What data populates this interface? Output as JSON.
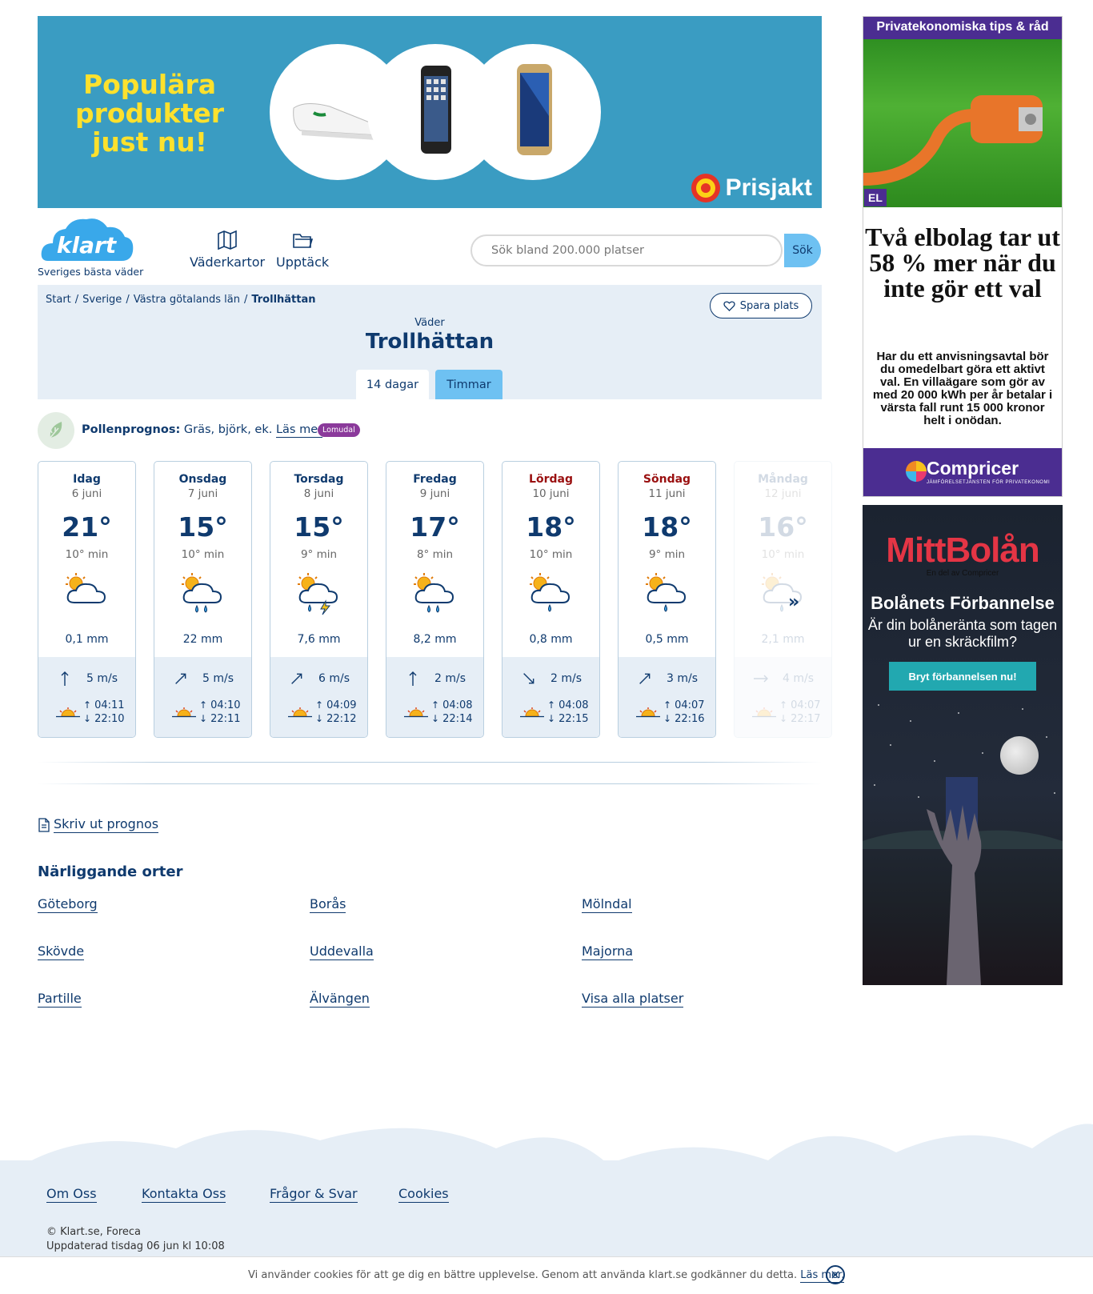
{
  "top_ad": {
    "headline": "Populära produkter just nu!",
    "brand": "Prisjakt",
    "colors": {
      "background": "#3a9cc2",
      "headline": "#fde12d"
    }
  },
  "header": {
    "logo_text": "klart",
    "tagline": "Sveriges bästa väder",
    "nav": [
      {
        "label": "Väderkartor",
        "icon": "map-icon"
      },
      {
        "label": "Upptäck",
        "icon": "folder-icon"
      }
    ],
    "search": {
      "placeholder": "Sök bland 200.000 platser",
      "button": "Sök"
    }
  },
  "location": {
    "breadcrumb": [
      "Start",
      "Sverige",
      "Västra götalands län",
      "Trollhättan"
    ],
    "save_label": "Spara plats",
    "kicker": "Väder",
    "city": "Trollhättan",
    "tabs": [
      "14 dagar",
      "Timmar"
    ]
  },
  "pollen": {
    "label": "Pollenprognos:",
    "text": "Gräs, björk, ek.",
    "link": "Läs mer",
    "badge": "Lomudal"
  },
  "days": [
    {
      "day": "Idag",
      "date": "6 juni",
      "temp": "21°",
      "min": "10° min",
      "icon": "partly-cloudy-icon",
      "precip": "0,1 mm",
      "wind": "5 m/s",
      "wind_dir": "N",
      "sunrise": "04:11",
      "sunset": "22:10",
      "weekend": false
    },
    {
      "day": "Onsdag",
      "date": "7 juni",
      "temp": "15°",
      "min": "10° min",
      "icon": "heavy-rain-icon",
      "precip": "22 mm",
      "wind": "5 m/s",
      "wind_dir": "NE",
      "sunrise": "04:10",
      "sunset": "22:11",
      "weekend": false
    },
    {
      "day": "Torsdag",
      "date": "8 juni",
      "temp": "15°",
      "min": "9° min",
      "icon": "thunder-rain-icon",
      "precip": "7,6 mm",
      "wind": "6 m/s",
      "wind_dir": "NE",
      "sunrise": "04:09",
      "sunset": "22:12",
      "weekend": false
    },
    {
      "day": "Fredag",
      "date": "9 juni",
      "temp": "17°",
      "min": "8° min",
      "icon": "heavy-rain-icon",
      "precip": "8,2 mm",
      "wind": "2 m/s",
      "wind_dir": "N",
      "sunrise": "04:08",
      "sunset": "22:14",
      "weekend": false
    },
    {
      "day": "Lördag",
      "date": "10 juni",
      "temp": "18°",
      "min": "10° min",
      "icon": "light-rain-icon",
      "precip": "0,8 mm",
      "wind": "2 m/s",
      "wind_dir": "SE",
      "sunrise": "04:08",
      "sunset": "22:15",
      "weekend": true
    },
    {
      "day": "Söndag",
      "date": "11 juni",
      "temp": "18°",
      "min": "9° min",
      "icon": "light-rain-icon",
      "precip": "0,5 mm",
      "wind": "3 m/s",
      "wind_dir": "NE",
      "sunrise": "04:07",
      "sunset": "22:16",
      "weekend": true
    },
    {
      "day": "Måndag",
      "date": "12 juni",
      "temp": "16°",
      "min": "10° min",
      "icon": "light-rain-icon",
      "precip": "2,1 mm",
      "wind": "4 m/s",
      "wind_dir": "E",
      "sunrise": "04:07",
      "sunset": "22:17",
      "weekend": false
    }
  ],
  "print_label": "Skriv ut prognos",
  "nearby": {
    "title": "Närliggande orter",
    "towns": [
      "Göteborg",
      "Borås",
      "Mölndal",
      "Skövde",
      "Uddevalla",
      "Majorna",
      "Partille",
      "Älvängen",
      "Visa alla platser"
    ]
  },
  "footer": {
    "links": [
      "Om Oss",
      "Kontakta Oss",
      "Frågor & Svar",
      "Cookies"
    ],
    "copyright": "© Klart.se, Foreca",
    "updated": "Uppdaterad tisdag 06 jun kl 10:08"
  },
  "cookie": {
    "text": "Vi använder cookies för att ge dig en bättre upplevelse. Genom att använda klart.se godkänner du detta.",
    "link": "Läs mer."
  },
  "ad_el": {
    "top_bar": "Privatekonomiska tips & råd",
    "tag": "EL",
    "headline": "Två elbolag tar ut 58 % mer när du inte gör ett val",
    "body": "Har du ett anvisningsavtal bör du omedelbart göra ett aktivt val. En villaägare som gör av med 20 000 kWh per år betalar i värsta fall runt 15 000 kronor helt i onödan.",
    "brand": "Compricer",
    "brand_sub": "JÄMFÖRELSETJÄNSTEN FÖR PRIVATEKONOMI"
  },
  "ad_bolan": {
    "brand": "MittBolån",
    "brand_sub": "En del av Compricer",
    "title": "Bolånets Förbannelse",
    "subtitle": "Är din bolåneränta som tagen ur en skräckfilm?",
    "cta": "Bryt förbannelsen nu!"
  },
  "colors": {
    "brand_blue": "#0f3a6e",
    "accent": "#6ec1f2",
    "panel": "#e6eef6",
    "weekend": "#9a1010"
  }
}
